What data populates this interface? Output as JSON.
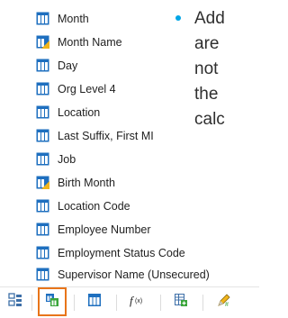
{
  "fields": [
    {
      "label": "Month",
      "icon": "dimension-icon"
    },
    {
      "label": "Month Name",
      "icon": "calculated-dimension-icon"
    },
    {
      "label": "Day",
      "icon": "dimension-icon"
    },
    {
      "label": "Org Level 4",
      "icon": "dimension-icon"
    },
    {
      "label": "Location",
      "icon": "dimension-icon"
    },
    {
      "label": "Last Suffix, First MI",
      "icon": "dimension-icon"
    },
    {
      "label": "Job",
      "icon": "dimension-icon"
    },
    {
      "label": "Birth Month",
      "icon": "calculated-dimension-icon"
    },
    {
      "label": "Location Code",
      "icon": "dimension-icon"
    },
    {
      "label": "Employee Number",
      "icon": "dimension-icon"
    },
    {
      "label": "Employment Status Code",
      "icon": "dimension-icon"
    },
    {
      "label": "Supervisor Name (Unsecured)",
      "icon": "dimension-icon"
    }
  ],
  "slide_text": {
    "lines": [
      "Add",
      "are",
      "not",
      "the",
      "calc"
    ]
  },
  "toolbar": {
    "buttons": [
      {
        "icon": "hierarchy-icon",
        "selected": false
      },
      {
        "icon": "data-items-icon",
        "selected": true
      },
      {
        "icon": "table-icon",
        "selected": false
      },
      {
        "icon": "function-icon",
        "selected": false
      },
      {
        "icon": "calculated-table-icon",
        "selected": false
      },
      {
        "icon": "pencil-calc-icon",
        "selected": false
      }
    ]
  },
  "colors": {
    "dimension_blue": "#1e6fbf",
    "calc_yellow": "#f1b51c",
    "bullet": "#00a5e6",
    "selection": "#e8751a"
  }
}
